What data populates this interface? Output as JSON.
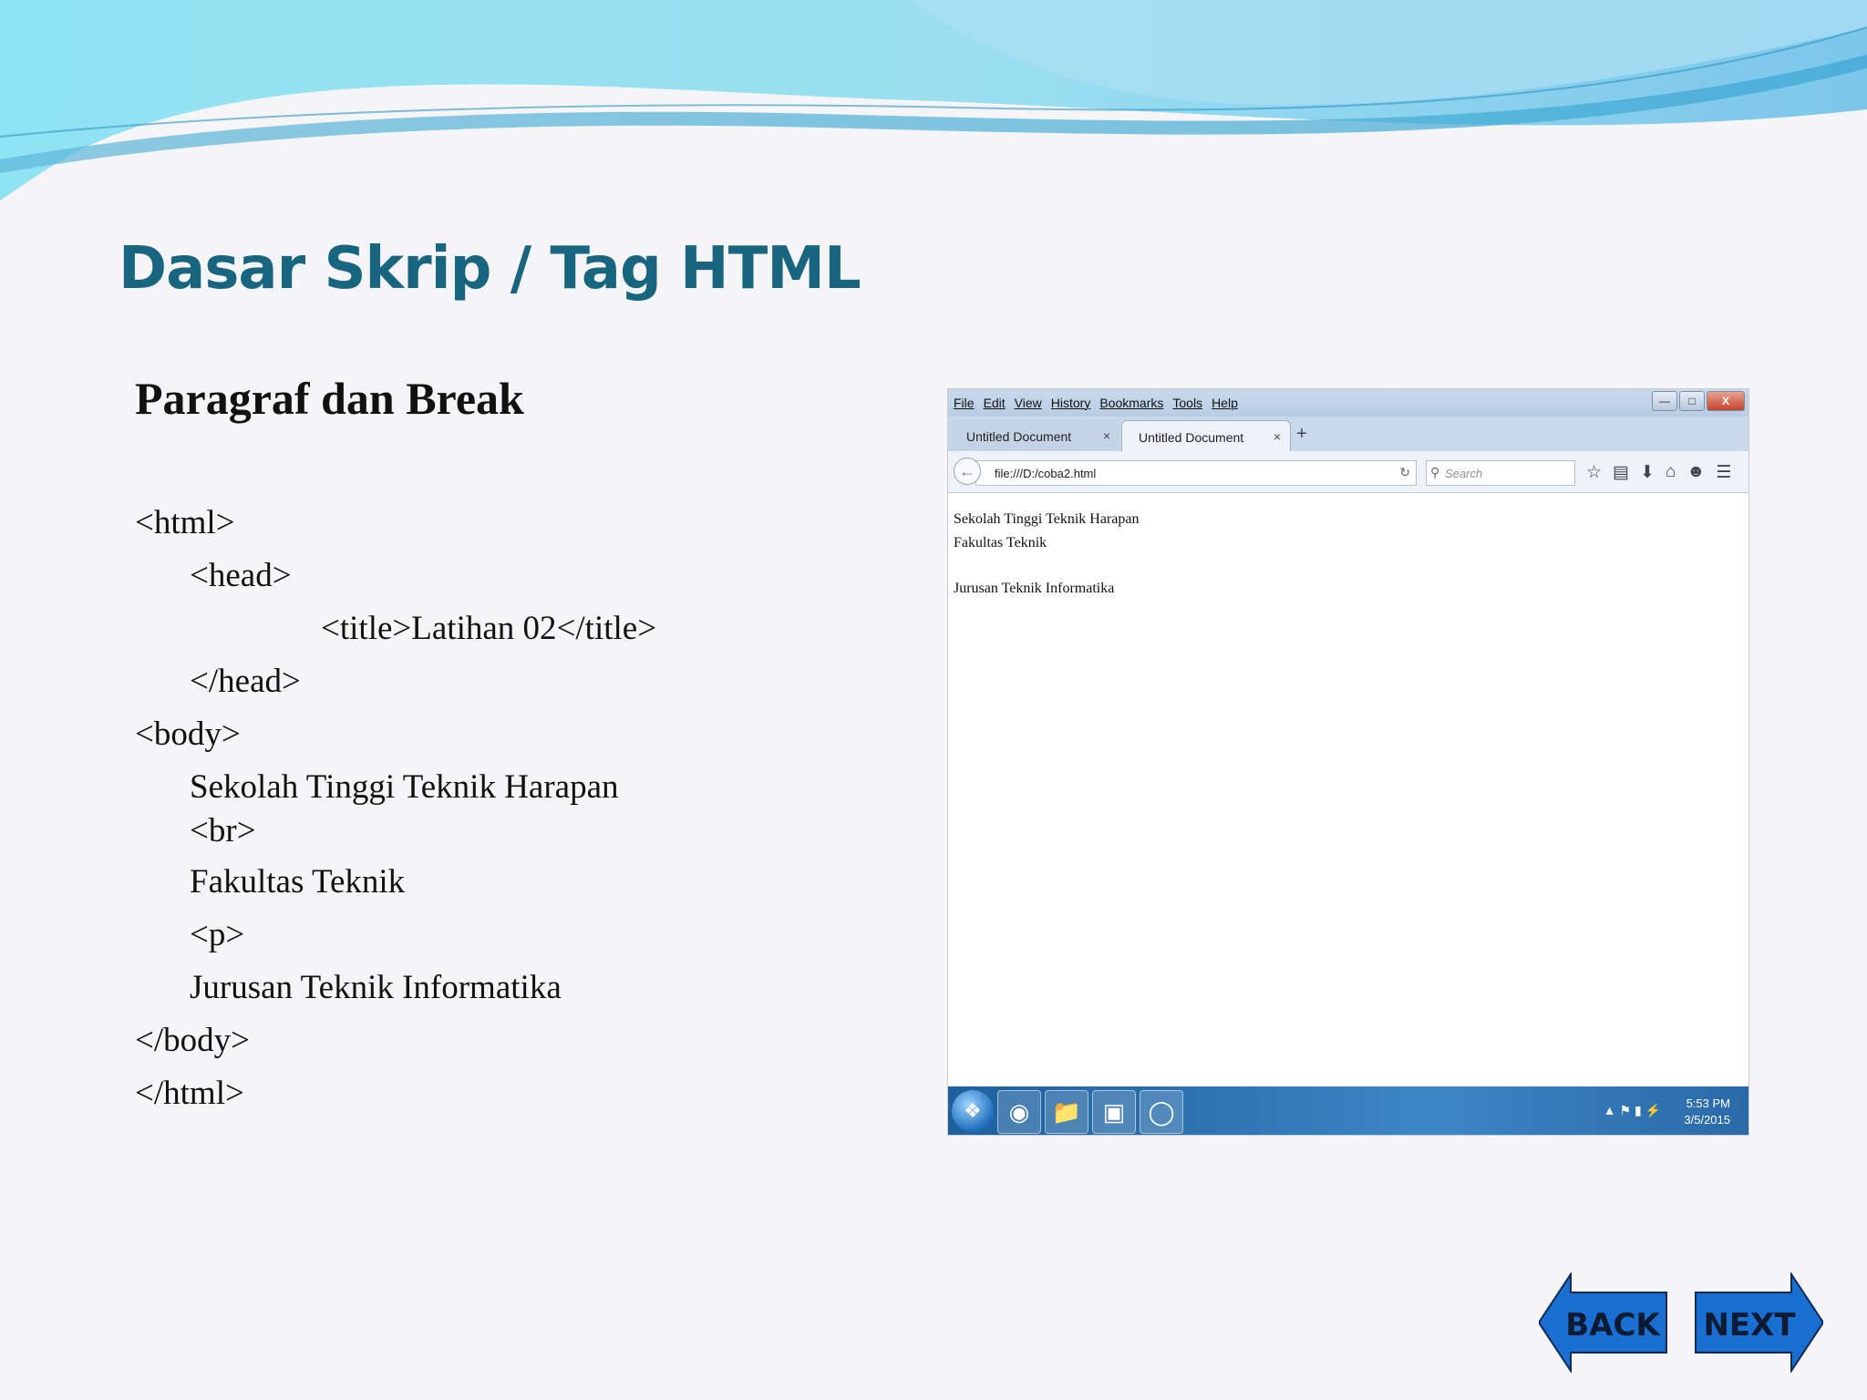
{
  "slide": {
    "title": "Dasar Skrip / Tag HTML",
    "subtitle": "Paragraf dan Break",
    "code_lines": [
      "<html>",
      "<head>",
      "<title>Latihan 02</title>",
      "</head>",
      "<body>",
      "Sekolah Tinggi Teknik Harapan",
      "<br>",
      "Fakultas Teknik",
      "<p>",
      "Jurusan Teknik Informatika",
      "</body>",
      "</html>"
    ]
  },
  "browser": {
    "menu": [
      "File",
      "Edit",
      "View",
      "History",
      "Bookmarks",
      "Tools",
      "Help"
    ],
    "tabs": [
      {
        "label": "Untitled Document"
      },
      {
        "label": "Untitled Document"
      }
    ],
    "url": "file:///D:/coba2.html",
    "search_placeholder": "Search",
    "content_lines": [
      "Sekolah Tinggi Teknik Harapan",
      "Fakultas Teknik",
      "",
      "Jurusan Teknik Informatika"
    ]
  },
  "taskbar": {
    "time": "5:53 PM",
    "date": "3/5/2015",
    "apps": [
      "firefox-icon",
      "file-explorer-icon",
      "powerpoint-icon",
      "dreamweaver-icon"
    ]
  },
  "nav": {
    "back_label": "BACK",
    "next_label": "NEXT"
  },
  "colors": {
    "title": "#17657f",
    "nav_button": "#1a6fd1"
  }
}
